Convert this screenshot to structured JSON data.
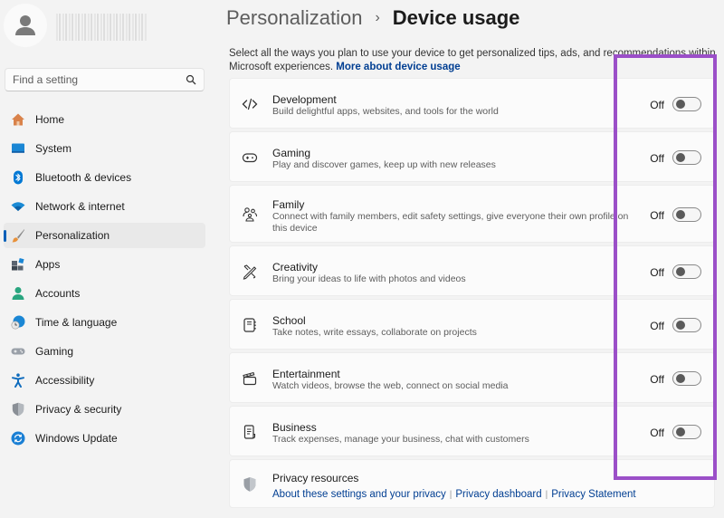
{
  "sidebar": {
    "avatar_icon": "person-icon",
    "search": {
      "placeholder": "Find a setting",
      "value": "",
      "icon": "search-icon"
    },
    "items": [
      {
        "label": "Home",
        "icon": "home-icon",
        "color": "#d9824a"
      },
      {
        "label": "System",
        "icon": "system-icon",
        "color": "#0f6cbd"
      },
      {
        "label": "Bluetooth & devices",
        "icon": "bluetooth-icon",
        "color": "#0078d4"
      },
      {
        "label": "Network & internet",
        "icon": "wifi-icon",
        "color": "#1a8ad4"
      },
      {
        "label": "Personalization",
        "icon": "brush-icon",
        "color": "#e8913a",
        "active": true
      },
      {
        "label": "Apps",
        "icon": "apps-icon",
        "color": "#4a5a6a"
      },
      {
        "label": "Accounts",
        "icon": "accounts-icon",
        "color": "#29a57f"
      },
      {
        "label": "Time & language",
        "icon": "globe-clock-icon",
        "color": "#1a86d4"
      },
      {
        "label": "Gaming",
        "icon": "gamepad-icon",
        "color": "#8a9099"
      },
      {
        "label": "Accessibility",
        "icon": "accessibility-icon",
        "color": "#0f6cbd"
      },
      {
        "label": "Privacy & security",
        "icon": "shield-icon",
        "color": "#7d8288"
      },
      {
        "label": "Windows Update",
        "icon": "update-icon",
        "color": "#1a7fd4"
      }
    ]
  },
  "header": {
    "parent": "Personalization",
    "separator": "›",
    "current": "Device usage"
  },
  "intro": {
    "text": "Select all the ways you plan to use your device to get personalized tips, ads, and recommendations within Microsoft experiences. ",
    "link": "More about device usage"
  },
  "usages": [
    {
      "title": "Development",
      "description": "Build delightful apps, websites, and tools for the world",
      "icon": "code-icon",
      "state": "Off",
      "on": false
    },
    {
      "title": "Gaming",
      "description": "Play and discover games, keep up with new releases",
      "icon": "gamepad-icon",
      "state": "Off",
      "on": false
    },
    {
      "title": "Family",
      "description": "Connect with family members, edit safety settings, give everyone their own profile on this device",
      "icon": "family-icon",
      "state": "Off",
      "on": false
    },
    {
      "title": "Creativity",
      "description": "Bring your ideas to life with photos and videos",
      "icon": "creativity-icon",
      "state": "Off",
      "on": false
    },
    {
      "title": "School",
      "description": "Take notes, write essays, collaborate on projects",
      "icon": "notebook-icon",
      "state": "Off",
      "on": false
    },
    {
      "title": "Entertainment",
      "description": "Watch videos, browse the web, connect on social media",
      "icon": "clapperboard-icon",
      "state": "Off",
      "on": false
    },
    {
      "title": "Business",
      "description": "Track expenses, manage your business, chat with customers",
      "icon": "document-icon",
      "state": "Off",
      "on": false
    }
  ],
  "privacy": {
    "title": "Privacy resources",
    "icon": "shield-icon",
    "links": [
      "About these settings and your privacy",
      "Privacy dashboard",
      "Privacy Statement"
    ]
  },
  "annotation": {
    "color": "#9b4fc8"
  }
}
